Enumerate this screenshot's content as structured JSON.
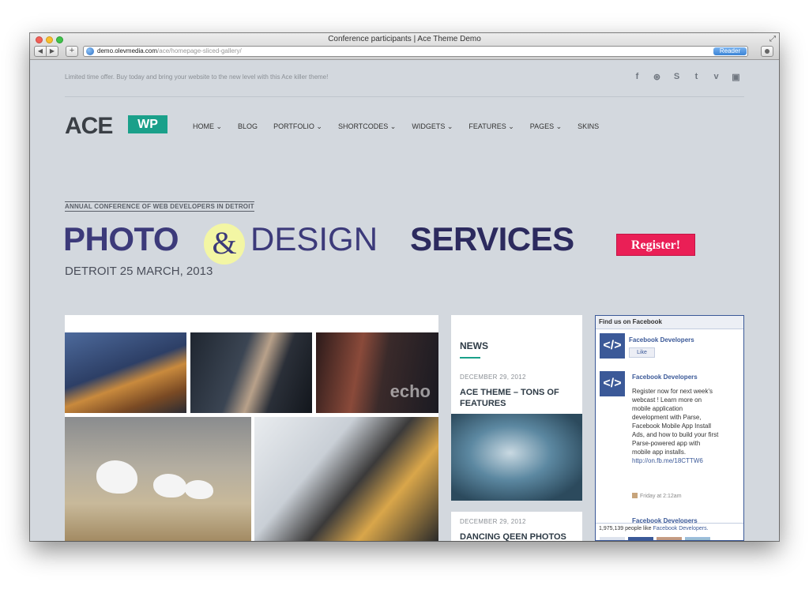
{
  "browser": {
    "title": "Conference participants | Ace Theme Demo",
    "url_domain": "demo.olevmedia.com",
    "url_path": "/ace/homepage-sliced-gallery/",
    "reader_label": "Reader",
    "back_icon": "◀",
    "fwd_icon": "▶",
    "add_icon": "+",
    "reload_icon": "↻",
    "resize_icon": "⤢"
  },
  "topbar": {
    "promo": "Limited time offer. Buy today and bring your website to the new level with this Ace killer theme!",
    "socials": [
      {
        "name": "facebook-icon",
        "glyph": "f"
      },
      {
        "name": "dribbble-icon",
        "glyph": "⊛"
      },
      {
        "name": "skype-icon",
        "glyph": "S"
      },
      {
        "name": "twitter-icon",
        "glyph": "t"
      },
      {
        "name": "vimeo-icon",
        "glyph": "v"
      },
      {
        "name": "youtube-icon",
        "glyph": "▣"
      }
    ]
  },
  "logo": {
    "text": "ACE",
    "badge": "WP"
  },
  "nav": [
    {
      "label": "HOME ⌄"
    },
    {
      "label": "BLOG"
    },
    {
      "label": "PORTFOLIO ⌄"
    },
    {
      "label": "SHORTCODES ⌄"
    },
    {
      "label": "WIDGETS ⌄"
    },
    {
      "label": "FEATURES ⌄"
    },
    {
      "label": "PAGES ⌄"
    },
    {
      "label": "SKINS"
    }
  ],
  "banner": {
    "tag": "ANNUAL CONFERENCE OF WEB DEVELOPERS IN DETROIT",
    "photo": "PHOTO",
    "amp": "&",
    "design": "DESIGN",
    "services": "SERVICES",
    "date": "DETROIT 25 MARCH, 2013",
    "register": "Register!"
  },
  "gallery": {
    "echo_text": "echo"
  },
  "news": {
    "heading": "NEWS",
    "items": [
      {
        "date": "DECEMBER 29, 2012",
        "title": "ACE THEME – TONS OF FEATURES"
      },
      {
        "date": "DECEMBER 29, 2012",
        "title": "DANCING QEEN PHOTOS FOR THE MAGAZINE"
      }
    ]
  },
  "facebook": {
    "header": "Find us on Facebook",
    "page_name": "Facebook Developers",
    "like": "Like",
    "post_text": "Register now for next week's webcast ! Learn more on mobile application development with Parse, Facebook Mobile App Install Ads, and how to build your first Parse-powered app with mobile app installs.",
    "post_link": "http://on.fb.me/18CTTW6",
    "post_time": "Friday at 2:12am",
    "next_name": "Facebook Developers",
    "likes_count": "1,975,139 people like",
    "likes_page": "Facebook Developers."
  },
  "colors": {
    "accent": "#1aa08a",
    "brand_navy": "#3c3a7a",
    "register": "#ea1f56",
    "facebook": "#3b5998"
  }
}
